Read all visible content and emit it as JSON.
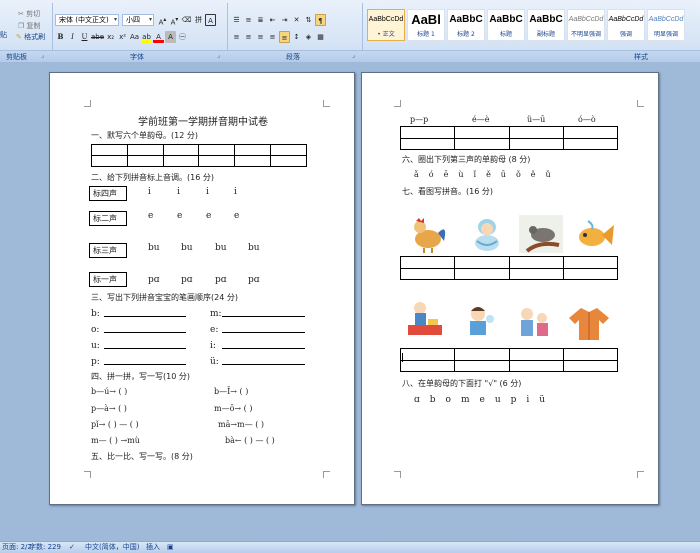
{
  "ribbon": {
    "clipboard": {
      "cut": "剪切",
      "copy": "复制",
      "format_painter": "格式刷",
      "paste_stub": "贴",
      "group": "剪贴板"
    },
    "font": {
      "family": "宋体 (中文正文)",
      "size": "小四",
      "group": "字体"
    },
    "paragraph": {
      "group": "段落"
    },
    "styles": {
      "group": "样式",
      "items": [
        {
          "sample": "AaBbCcDd",
          "name": "• 正文"
        },
        {
          "sample": "AaBl",
          "name": "标题 1"
        },
        {
          "sample": "AaBbC",
          "name": "标题 2"
        },
        {
          "sample": "AaBbC",
          "name": "标题"
        },
        {
          "sample": "AaBbC",
          "name": "副标题"
        },
        {
          "sample": "AaBbCcDd",
          "name": "不明显强调"
        },
        {
          "sample": "AaBbCcDd",
          "name": "强调"
        },
        {
          "sample": "AaBbCcDd",
          "name": "明显强调"
        }
      ]
    }
  },
  "colors": {
    "highlight": "#ffff00",
    "font_color": "#ff0000",
    "ribbon_text": "#15428b"
  },
  "page1": {
    "title": "学前班第一学期拼音期中试卷",
    "q1": "一、默写六个单韵母。(12 分)",
    "q2": "二、给下列拼音标上音调。(16 分)",
    "tones": [
      {
        "label": "标四声",
        "syllables": [
          "i",
          "i",
          "i",
          "i"
        ]
      },
      {
        "label": "标二声",
        "syllables": [
          "e",
          "e",
          "e",
          "e"
        ]
      },
      {
        "label": "标三声",
        "syllables": [
          "bu",
          "bu",
          "bu",
          "bu"
        ]
      },
      {
        "label": "标一声",
        "syllables": [
          "pɑ",
          "pɑ",
          "pɑ",
          "pɑ"
        ]
      }
    ],
    "q3": "三、写出下列拼音宝宝的笔画顺序(24 分)",
    "strokes": [
      {
        "left": "b:",
        "right": "m:"
      },
      {
        "left": "o:",
        "right": "e:"
      },
      {
        "left": "u:",
        "right": "i:"
      },
      {
        "left": "p:",
        "right": "ü:"
      }
    ],
    "q4": "四、拼一拼，写一写(10 分)",
    "spell": [
      {
        "left": "b—ú→ (      )",
        "right": "b—Ī→ (      )"
      },
      {
        "left": "p—à→ (      )",
        "right": "m—ō→ (      )"
      },
      {
        "left": "pǐ→ (      ) — (      )",
        "right": "mā→m— (      )"
      },
      {
        "left": "m— (      ) →mù",
        "right": "bà← (      ) — (      )"
      }
    ],
    "q5": "五、比一比、写一写。(8 分)"
  },
  "page2": {
    "pinyin_row": [
      "p—p",
      "é—è",
      "ü—ū",
      "ó—ò"
    ],
    "q6": "六、圈出下列第三声的单韵母 (8 分)",
    "q6_items": [
      "ǎ",
      "ó",
      "ē",
      "ù",
      "ǐ",
      "ě",
      "ū",
      "ǒ",
      "ě",
      "ǔ"
    ],
    "q7": "七、看图写拼音。(16 分)",
    "q8": "八、在单韵母的下面打 \"√\" (6 分)",
    "q8_items": [
      "ɑ",
      "b",
      "o",
      "m",
      "e",
      "u",
      "p",
      "i",
      "ü"
    ]
  },
  "status": {
    "page": "页面: 2/2",
    "words": "字数: 229",
    "lang": "中文(简体，中国)",
    "mode": "插入"
  }
}
